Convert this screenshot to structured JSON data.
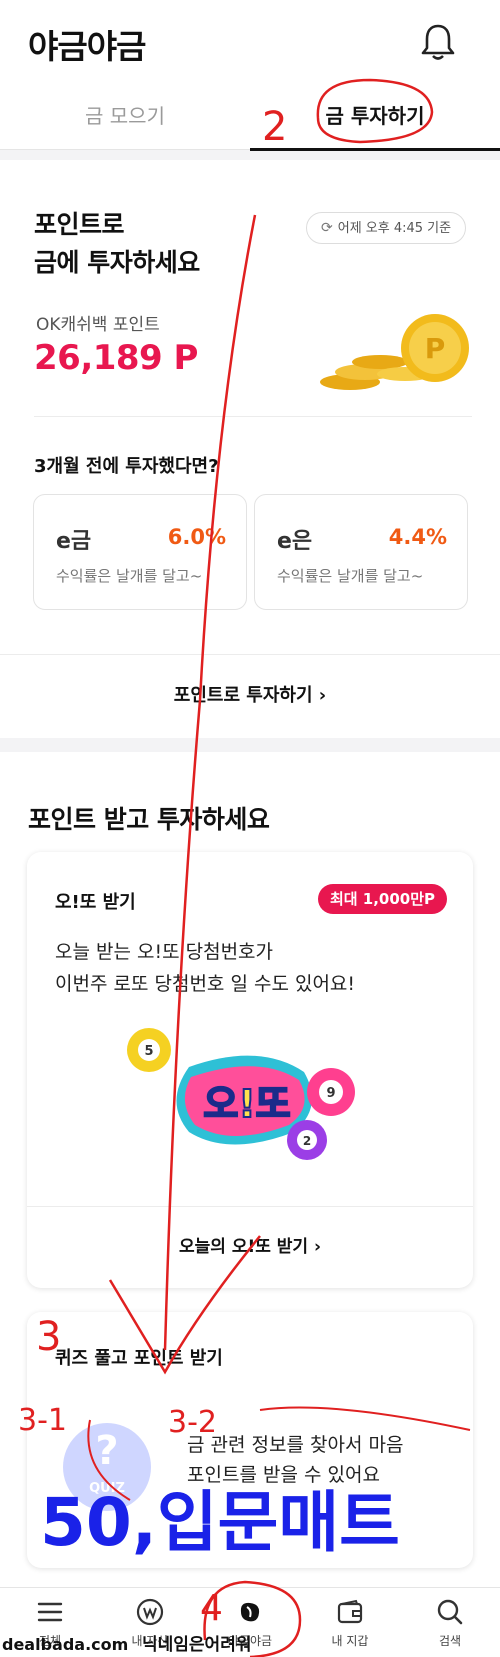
{
  "header": {
    "title": "야금야금"
  },
  "tabs": [
    {
      "label": "금 모으기"
    },
    {
      "label": "금 투자하기"
    }
  ],
  "points_card": {
    "title_line1": "포인트로",
    "title_line2": "금에 투자하세요",
    "timestamp": "어제 오후 4:45 기준",
    "points_label": "OK캐쉬백 포인트",
    "points_value": "26,189 P",
    "question": "3개월 전에 투자했다면?",
    "rates": [
      {
        "name": "e금",
        "value": "6.0%",
        "sub": "수익률은 날개를 달고~"
      },
      {
        "name": "e은",
        "value": "4.4%",
        "sub": "수익률은 날개를 달고~"
      }
    ],
    "invest_link": "포인트로 투자하기 ›"
  },
  "section2": {
    "title": "포인트 받고 투자하세요"
  },
  "lotto_card": {
    "title": "오!또 받기",
    "badge": "최대 1,000만P",
    "desc_line1": "오늘 받는 오!또 당첨번호가",
    "desc_line2": "이번주 로또 당첨번호 일 수도 있어요!",
    "logo_text": "오!또",
    "balls": [
      "5",
      "9",
      "2"
    ],
    "link": "오늘의 오!또 받기 ›"
  },
  "quiz_card": {
    "title": "퀴즈 풀고 포인트 받기",
    "desc_line1": "금 관련 정보를 찾아서 마음",
    "desc_line2": "포인트를 받을 수 있어요",
    "quiz_badge": "QUIZ"
  },
  "bottom_nav": [
    {
      "label": "전체",
      "icon": "menu-icon"
    },
    {
      "label": "내 자산",
      "icon": "won-icon"
    },
    {
      "label": "야금야금",
      "icon": "gold-bean-icon"
    },
    {
      "label": "내 지갑",
      "icon": "wallet-icon"
    },
    {
      "label": "검색",
      "icon": "search-icon"
    }
  ],
  "annotations": {
    "num_2": "2",
    "num_3": "3",
    "num_3_1": "3-1",
    "num_3_2": "3-2",
    "num_4": "4",
    "big_text": "50,입문매트",
    "watermark_left": "dealbada.com",
    "watermark_right": "닉네임은어려워"
  },
  "colors": {
    "accent_pink": "#e8174f",
    "rate_orange": "#f05a14",
    "scribble_red": "#e02020",
    "scribble_blue": "#1a22e8"
  }
}
